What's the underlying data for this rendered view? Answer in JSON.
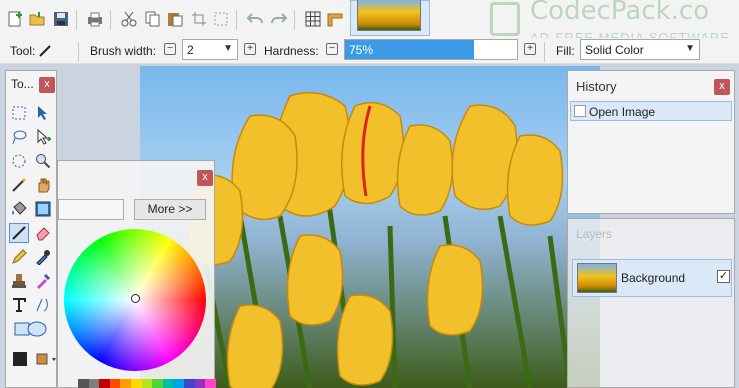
{
  "toolbar": {
    "icons": [
      "new-image-icon",
      "open-file-icon",
      "save-icon",
      "print-icon",
      "cut-icon",
      "copy-icon",
      "paste-icon",
      "crop-icon",
      "deselect-icon",
      "undo-icon",
      "redo-icon",
      "grid-icon",
      "ruler-icon"
    ]
  },
  "watermark": {
    "brand": "CodecPack.co",
    "tagline": "AD-FREE MEDIA SOFTWARE"
  },
  "options": {
    "tool_label": "Tool:",
    "brush_width_label": "Brush width:",
    "brush_width_value": "2",
    "hardness_label": "Hardness:",
    "hardness_value": "75%",
    "hardness_fraction": 0.75,
    "fill_label": "Fill:",
    "fill_value": "Solid Color"
  },
  "tools_window": {
    "title": "To...",
    "close": "x"
  },
  "colors_window": {
    "close": "x",
    "more_button": "More >>",
    "palette": [
      "#555555",
      "#7f7f7f",
      "#c00000",
      "#ff4a00",
      "#ff9e00",
      "#ffd800",
      "#b5e61d",
      "#4cd63a",
      "#00c0a0",
      "#00a2e8",
      "#3f48cc",
      "#8e34c2",
      "#ff44cc"
    ]
  },
  "history_window": {
    "title": "History",
    "close": "x",
    "items": [
      "Open Image"
    ]
  },
  "layers_window": {
    "title": "Layers",
    "items": [
      {
        "name": "Background",
        "visible": true
      }
    ]
  },
  "colors": {
    "accent": "#3b9be8",
    "close": "#c0565a",
    "selection": "#dbe8f7"
  }
}
